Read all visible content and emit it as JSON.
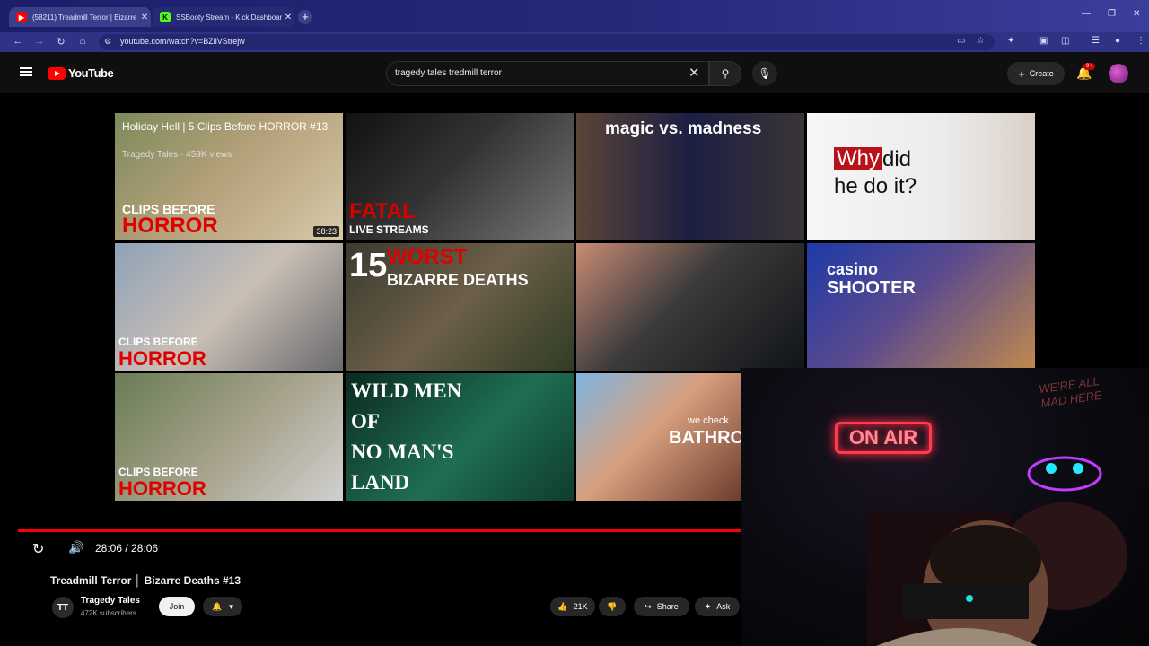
{
  "browser": {
    "tabs": [
      {
        "title": "(58211) Treadmill Terror | Bizarre",
        "fav": "▶",
        "fav_color": "#ff0000"
      },
      {
        "title": "SSBooty Stream - Kick Dashboard",
        "fav": "K",
        "fav_color": "#53fc18"
      }
    ],
    "url": "youtube.com/watch?v=BZilVStrejw",
    "window_controls": [
      "—",
      "❐",
      "✕"
    ]
  },
  "youtube": {
    "logo_text": "YouTube",
    "search_query": "tragedy tales tredmill terror",
    "create_label": "Create",
    "notification_badge": "9+"
  },
  "grid": [
    {
      "overlay": "Holiday Hell | 5 Clips Before HORROR #13",
      "sub": "Tragedy Tales · 459K views",
      "t1": "CLIPS BEFORE",
      "t2": "HORROR",
      "duration": "38:23",
      "bg": "linear-gradient(135deg,#7d8a5a 0%,#b7a27c 50%,#d7c9a9 100%)"
    },
    {
      "t1": "FATAL",
      "t2": "LIVE STREAMS",
      "bg": "linear-gradient(135deg,#111 0%,#333 45%,#777 100%)"
    },
    {
      "t1": "magic vs. madness",
      "bg": "linear-gradient(90deg,#5a4437 0%,#1c1f42 50%,#3a3437 100%)"
    },
    {
      "t1": "Why",
      "t2": "did",
      "t3": "he do it?",
      "bg": "linear-gradient(90deg,#f6f6f6 0%,#ececec 60%,#d9d0c6 100%)"
    },
    {
      "t1": "CLIPS BEFORE",
      "t2": "HORROR",
      "bg": "linear-gradient(135deg,#8fa2b8 0%,#c9bfb5 50%,#6b6a6e 100%)"
    },
    {
      "t1": "15",
      "t2": "WORST",
      "t3": "BIZARRE DEATHS",
      "bg": "linear-gradient(135deg,#3a3a2e 0%,#6d5f49 50%,#2f3c24 100%)"
    },
    {
      "bg": "linear-gradient(135deg,#c98b74 0%,#3a3a3a 45%,#111418 100%)"
    },
    {
      "t1": "casino",
      "t2": "SHOOTER",
      "bg": "linear-gradient(135deg,#1d3aa8 0%,#5a4a8e 45%,#c08a4c 100%)"
    },
    {
      "t1": "CLIPS BEFORE",
      "t2": "HORROR",
      "bg": "linear-gradient(135deg,#6a7d55 0%,#a9a48e 55%,#d0d0cf 100%)"
    },
    {
      "t1": "WILD MEN",
      "t2": "OF",
      "t3": "NO MAN'S",
      "t4": "LAND",
      "bg": "linear-gradient(135deg,#0b2a20 0%,#1f6f52 55%,#0f3c2c 100%)"
    },
    {
      "t1": "we check",
      "t2": "BATHRO",
      "bg": "linear-gradient(135deg,#7fb5e0 0%,#d7a07e 45%,#6c3b2c 100%)"
    }
  ],
  "player": {
    "time": "28:06 / 28:06",
    "title": "Treadmill Terror │ Bizarre Deaths #13",
    "channel": "Tragedy Tales",
    "subscribers": "472K subscribers",
    "join": "Join",
    "likes": "21K",
    "share": "Share",
    "ask": "Ask"
  },
  "stream": {
    "on_air": "ON AIR",
    "neon_sign": "WE'RE ALL MAD HERE"
  }
}
